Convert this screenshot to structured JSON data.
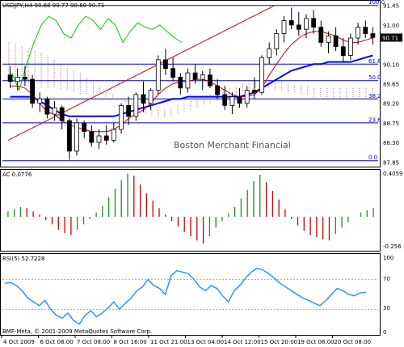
{
  "main": {
    "symbol_label": "USDJPY,H4  90.68 90.77 90.60 90.71",
    "price_ticks": [
      "91.45",
      "91.00",
      "90.10",
      "89.65",
      "89.20",
      "88.75",
      "88.30",
      "87.85"
    ],
    "price_range": [
      87.8,
      91.5
    ],
    "current_price": "90.71",
    "watermark": "Boston Merchant Financial",
    "fib_levels": [
      {
        "label": "100.0",
        "price": 91.45
      },
      {
        "label": "61.8",
        "price": 90.1
      },
      {
        "label": "50.0",
        "price": 89.72
      },
      {
        "label": "38.2",
        "price": 89.3
      },
      {
        "label": "23.6",
        "price": 88.75
      },
      {
        "label": "0.0",
        "price": 87.88
      }
    ]
  },
  "ac": {
    "label": "AC 0.0776",
    "ticks": [
      "0.4059",
      "-0.256"
    ],
    "range": [
      -0.3,
      0.42
    ]
  },
  "rsi": {
    "label": "RSI(5) 52.7228",
    "ticks": [
      "100",
      "70",
      "30",
      "0"
    ],
    "range": [
      0,
      100
    ]
  },
  "footer": {
    "copyright": "BMF-Meta, © 2001-2009 MetaQuotes Software Corp."
  },
  "time_axis": [
    "4 Oct 2009",
    "6 Oct 08:00",
    "7 Oct 08:00",
    "8 Oct 16:00",
    "11 Oct 21:00",
    "13 Oct 04:00",
    "14 Oct 12:00",
    "15 Oct 20:00",
    "19 Oct 08:00",
    "20 Oct 08:00"
  ],
  "colors": {
    "up": "#228b22",
    "down": "#cc0000",
    "kijun": "#0000ff",
    "tenkan": "#cc0000",
    "chikou": "#00cc00",
    "cloud": "#c08080",
    "fib": "#0000cc"
  },
  "chart_data": [
    {
      "type": "candlestick",
      "title": "USDJPY,H4",
      "ylim": [
        87.85,
        91.45
      ],
      "ohlc": [
        [
          89.85,
          90.05,
          89.55,
          89.7
        ],
        [
          89.7,
          90.0,
          89.5,
          89.8
        ],
        [
          89.8,
          90.05,
          89.6,
          89.75
        ],
        [
          89.75,
          89.85,
          89.1,
          89.2
        ],
        [
          89.2,
          89.45,
          89.0,
          89.3
        ],
        [
          89.3,
          89.35,
          88.85,
          88.95
        ],
        [
          88.95,
          89.25,
          88.8,
          89.1
        ],
        [
          89.1,
          89.15,
          88.6,
          88.8
        ],
        [
          88.8,
          88.85,
          87.9,
          88.1
        ],
        [
          88.1,
          88.85,
          88.0,
          88.75
        ],
        [
          88.75,
          88.8,
          88.4,
          88.55
        ],
        [
          88.55,
          88.7,
          88.2,
          88.3
        ],
        [
          88.3,
          88.6,
          88.15,
          88.45
        ],
        [
          88.45,
          88.7,
          88.25,
          88.35
        ],
        [
          88.35,
          88.75,
          88.3,
          88.6
        ],
        [
          88.6,
          89.2,
          88.5,
          89.15
        ],
        [
          89.15,
          89.35,
          88.7,
          88.9
        ],
        [
          88.9,
          89.45,
          88.8,
          89.4
        ],
        [
          89.4,
          89.7,
          89.0,
          89.2
        ],
        [
          89.2,
          89.55,
          89.05,
          89.5
        ],
        [
          89.5,
          90.3,
          89.4,
          90.2
        ],
        [
          90.2,
          90.45,
          89.85,
          90.0
        ],
        [
          90.0,
          90.25,
          89.7,
          89.8
        ],
        [
          89.8,
          89.9,
          89.4,
          89.55
        ],
        [
          89.55,
          90.0,
          89.45,
          89.9
        ],
        [
          89.9,
          90.1,
          89.65,
          89.75
        ],
        [
          89.75,
          89.95,
          89.5,
          89.85
        ],
        [
          89.85,
          90.0,
          89.55,
          89.6
        ],
        [
          89.6,
          89.75,
          89.3,
          89.4
        ],
        [
          89.4,
          89.6,
          89.05,
          89.15
        ],
        [
          89.15,
          89.45,
          88.95,
          89.35
        ],
        [
          89.35,
          89.55,
          89.1,
          89.2
        ],
        [
          89.2,
          89.6,
          89.1,
          89.5
        ],
        [
          89.5,
          89.8,
          89.3,
          89.45
        ],
        [
          89.45,
          90.3,
          89.4,
          90.25
        ],
        [
          90.25,
          90.6,
          90.1,
          90.45
        ],
        [
          90.45,
          90.9,
          90.3,
          90.8
        ],
        [
          90.8,
          91.2,
          90.6,
          91.1
        ],
        [
          91.1,
          91.4,
          90.9,
          91.0
        ],
        [
          91.0,
          91.3,
          90.75,
          90.9
        ],
        [
          90.9,
          91.25,
          90.7,
          91.15
        ],
        [
          91.15,
          91.35,
          90.8,
          90.95
        ],
        [
          90.95,
          91.1,
          90.5,
          90.6
        ],
        [
          90.6,
          90.85,
          90.35,
          90.75
        ],
        [
          90.75,
          90.95,
          90.4,
          90.5
        ],
        [
          90.5,
          90.7,
          90.15,
          90.3
        ],
        [
          90.3,
          90.8,
          90.2,
          90.7
        ],
        [
          90.7,
          91.05,
          90.55,
          90.95
        ],
        [
          90.95,
          91.1,
          90.7,
          90.8
        ],
        [
          90.8,
          90.95,
          90.55,
          90.71
        ]
      ],
      "series": [
        {
          "name": "Tenkan",
          "values": [
            89.6,
            89.6,
            89.55,
            89.4,
            89.2,
            89.0,
            88.95,
            88.8,
            88.7,
            88.65,
            88.6,
            88.55,
            88.55,
            88.55,
            88.6,
            88.7,
            88.85,
            88.95,
            89.05,
            89.2,
            89.4,
            89.55,
            89.65,
            89.7,
            89.7,
            89.75,
            89.75,
            89.7,
            89.6,
            89.5,
            89.4,
            89.35,
            89.35,
            89.4,
            89.55,
            89.85,
            90.1,
            90.35,
            90.55,
            90.7,
            90.8,
            90.85,
            90.85,
            90.8,
            90.75,
            90.65,
            90.6,
            90.6,
            90.65,
            90.7
          ]
        },
        {
          "name": "Kijun",
          "values": [
            89.35,
            89.35,
            89.35,
            89.35,
            89.25,
            89.15,
            89.05,
            88.95,
            88.9,
            88.9,
            88.9,
            88.9,
            88.9,
            88.9,
            88.9,
            88.95,
            89.0,
            89.05,
            89.1,
            89.15,
            89.2,
            89.25,
            89.3,
            89.3,
            89.35,
            89.35,
            89.35,
            89.35,
            89.35,
            89.35,
            89.35,
            89.35,
            89.4,
            89.45,
            89.55,
            89.65,
            89.75,
            89.85,
            89.95,
            90.0,
            90.05,
            90.1,
            90.1,
            90.15,
            90.15,
            90.15,
            90.15,
            90.2,
            90.25,
            90.3
          ]
        },
        {
          "name": "Chikou",
          "values": [
            89.9,
            89.5,
            90.1,
            90.6,
            91.0,
            91.2,
            91.1,
            90.8,
            90.7,
            91.0,
            91.2,
            91.1,
            90.9,
            91.15,
            91.0,
            90.6,
            90.85,
            91.05,
            90.95,
            90.9,
            91.0,
            90.85,
            90.7,
            90.6
          ]
        }
      ]
    },
    {
      "type": "bar",
      "title": "AC 0.0776",
      "ylim": [
        -0.256,
        0.4059
      ],
      "values": [
        0.05,
        0.07,
        0.09,
        0.08,
        0.05,
        0.02,
        -0.03,
        -0.07,
        -0.12,
        -0.15,
        -0.17,
        -0.12,
        -0.07,
        -0.02,
        0.04,
        0.1,
        0.18,
        0.26,
        0.34,
        0.4,
        0.38,
        0.3,
        0.22,
        0.15,
        0.08,
        0.02,
        -0.04,
        -0.09,
        -0.14,
        -0.18,
        -0.22,
        -0.25,
        -0.18,
        -0.1,
        -0.04,
        0.03,
        0.09,
        0.17,
        0.25,
        0.33,
        0.39,
        0.32,
        0.24,
        0.16,
        0.07,
        -0.02,
        -0.08,
        -0.13,
        -0.17,
        -0.19,
        -0.21,
        -0.22,
        -0.16,
        -0.1,
        -0.05,
        0.0,
        0.04,
        0.06,
        0.08
      ]
    },
    {
      "type": "line",
      "title": "RSI(5) 52.7228",
      "ylim": [
        0,
        100
      ],
      "series": [
        {
          "name": "RSI(5)",
          "values": [
            65,
            66,
            62,
            55,
            45,
            40,
            35,
            42,
            30,
            22,
            18,
            25,
            15,
            10,
            22,
            28,
            20,
            25,
            32,
            40,
            30,
            38,
            45,
            55,
            60,
            70,
            62,
            58,
            50,
            75,
            82,
            80,
            78,
            70,
            60,
            55,
            62,
            58,
            48,
            40,
            55,
            62,
            72,
            80,
            85,
            83,
            78,
            72,
            65,
            60,
            55,
            50,
            45,
            42,
            38,
            35,
            42,
            50,
            58,
            55,
            50,
            48,
            52,
            53
          ]
        }
      ]
    }
  ]
}
